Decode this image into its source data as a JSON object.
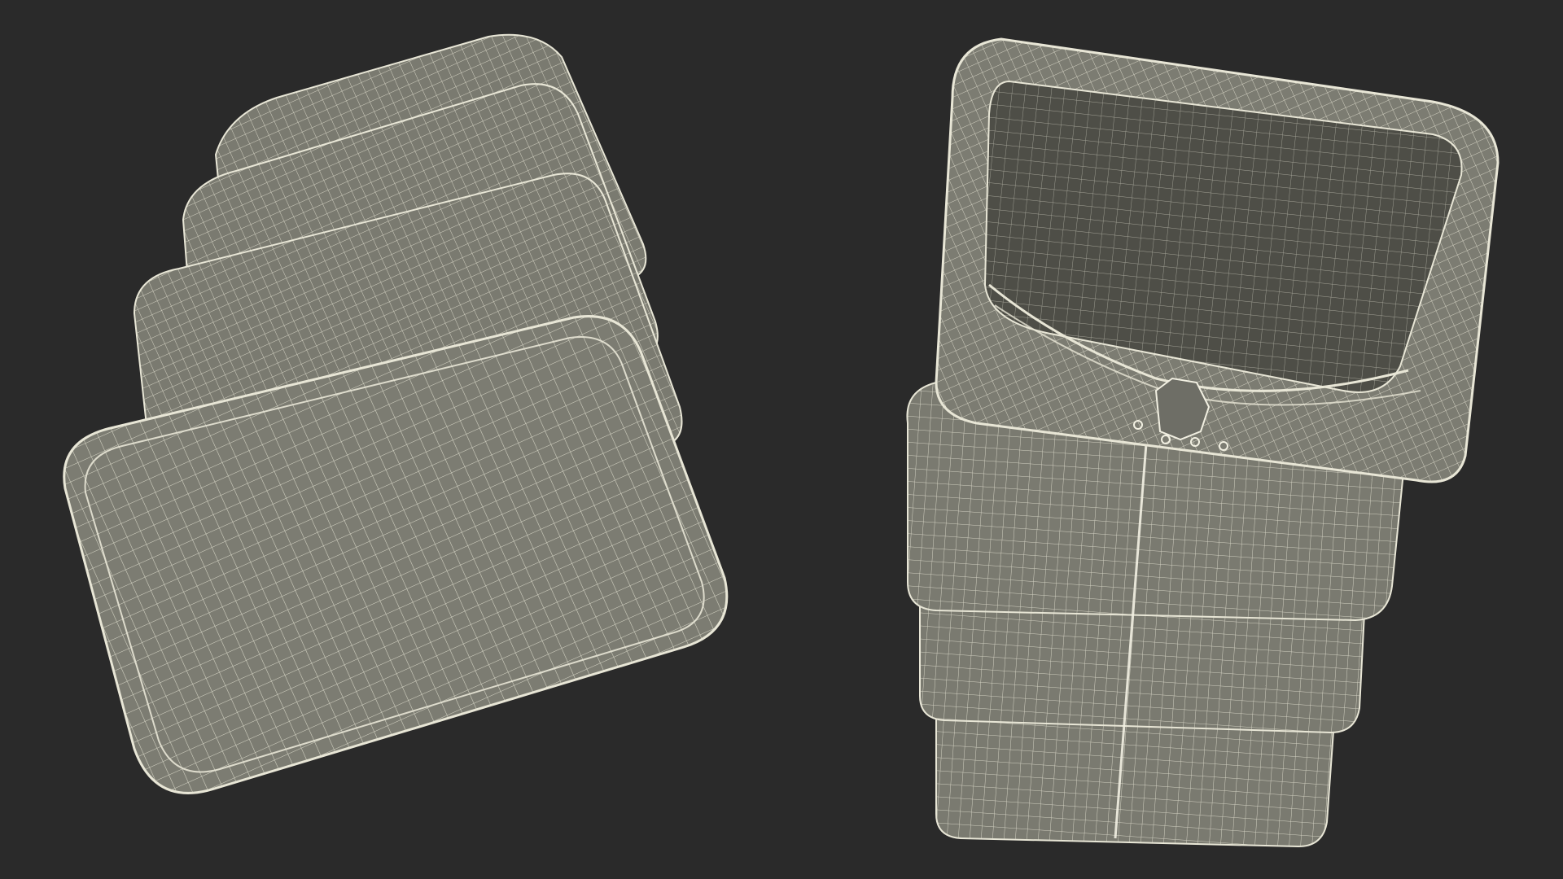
{
  "scene": {
    "background_color": "#2a2a2a",
    "mesh_fill_color": "#7a7a70",
    "mesh_dark_fill_color": "#5a5a52",
    "wire_color": "#e8e6d6",
    "objects": [
      {
        "name": "collapsed-silicone-container-bottom-view"
      },
      {
        "name": "expanded-silicone-container-top-view"
      }
    ]
  }
}
